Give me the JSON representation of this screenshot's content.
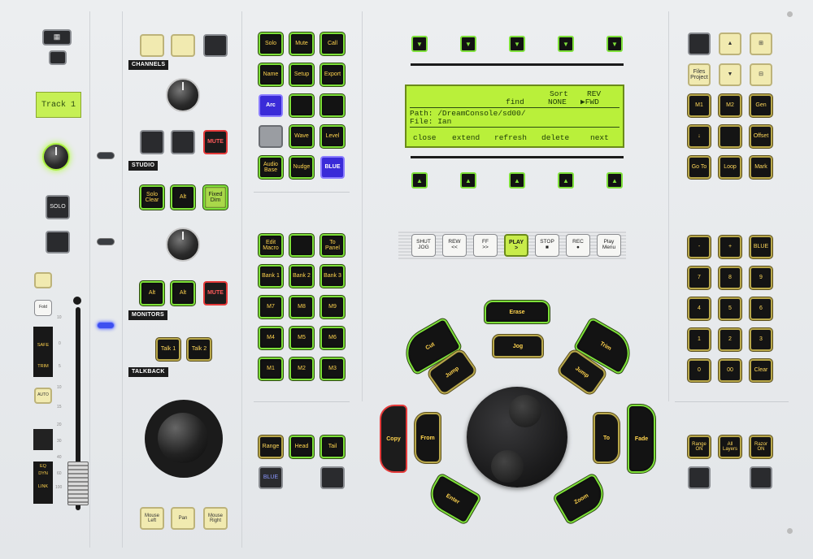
{
  "colors": {
    "panel": "#e8eaed",
    "key_green": "#7ee03a",
    "lcd": "#b9f03a",
    "blue_key": "#3a2bd8",
    "mute_red": "#e43a3a"
  },
  "strip": {
    "track_name": "Track 1",
    "solo": "SOLO",
    "auto": "AUTO",
    "safe_labels": [
      "SAFE",
      "TRIM"
    ],
    "dyn_labels": [
      "EQ",
      "DYN",
      "LINK"
    ],
    "fader_scale": [
      "10",
      "0",
      "5",
      "10",
      "15",
      "20",
      "30",
      "40",
      "60",
      "100"
    ],
    "button_labels": {
      "small1": "",
      "small2": "Fold"
    }
  },
  "sections": {
    "channels": "CHANNELS",
    "studio": "STUDIO",
    "monitors": "MONITORS",
    "talkback": "TALKBACK"
  },
  "channels": {
    "studio_mute": "MUTE",
    "solo_clear": "Solo Clear",
    "alt1": "Alt",
    "fixed_dim": "Fixed Dim",
    "mon_alt1": "Alt",
    "mon_alt2": "Alt",
    "mon_mute": "MUTE",
    "talk1": "Talk 1",
    "talk2": "Talk 2",
    "mouse_left": "Mouse Left",
    "pan": "Pan",
    "mouse_right": "Mouse Right"
  },
  "keys_top": [
    {
      "label": "Solo",
      "style": "green"
    },
    {
      "label": "Mute",
      "style": "green"
    },
    {
      "label": "Call",
      "style": "green"
    },
    {
      "label": "Name",
      "style": "green"
    },
    {
      "label": "Setup",
      "style": "green"
    },
    {
      "label": "Export",
      "style": "green"
    },
    {
      "label": "Arc",
      "style": "blue"
    },
    {
      "label": "",
      "style": "green"
    },
    {
      "label": "",
      "style": "green"
    },
    {
      "label": "",
      "style": "grey"
    },
    {
      "label": "Wave",
      "style": "green"
    },
    {
      "label": "Level",
      "style": "green"
    },
    {
      "label": "Audio Base",
      "style": "green"
    },
    {
      "label": "Nudge",
      "style": "green"
    },
    {
      "label": "BLUE",
      "style": "blue"
    }
  ],
  "keys_mid": [
    {
      "label": "Edit Macro"
    },
    {
      "label": ""
    },
    {
      "label": "To Panel"
    },
    {
      "label": "Bank 1"
    },
    {
      "label": "Bank 2"
    },
    {
      "label": "Bank 3"
    },
    {
      "label": "M7"
    },
    {
      "label": "M8"
    },
    {
      "label": "M9"
    },
    {
      "label": "M4"
    },
    {
      "label": "M5"
    },
    {
      "label": "M6"
    },
    {
      "label": "M1"
    },
    {
      "label": "M2"
    },
    {
      "label": "M3"
    }
  ],
  "keys_bottom": {
    "range": "Range",
    "head": "Head",
    "tail": "Tail",
    "blue": "BLUE"
  },
  "lcd": {
    "header_sort": "Sort",
    "header_rev": "REV",
    "find": "find",
    "none": "NONE",
    "fwd": "▶FWD",
    "path": "Path: /DreamConsole/sd00/",
    "file": "File: Ian",
    "softkeys": [
      "close",
      "extend",
      "refresh",
      "delete",
      "next"
    ]
  },
  "transport": [
    {
      "label": "SHUT\nJOG",
      "lit": false
    },
    {
      "label": "REW\n<<",
      "lit": false
    },
    {
      "label": "FF\n>>",
      "lit": false
    },
    {
      "label": "PLAY\n>",
      "lit": true
    },
    {
      "label": "STOP\n■",
      "lit": false
    },
    {
      "label": "REC\n●",
      "lit": false
    },
    {
      "label": "Play\nMenu",
      "lit": false
    }
  ],
  "jog": {
    "erase": "Erase",
    "cut": "Cut",
    "trim": "Trim",
    "jog": "Jog",
    "jump_left": "Jump",
    "jump_right": "Jump",
    "copy": "Copy",
    "from": "From",
    "to": "To",
    "fade": "Fade",
    "enter": "Enter",
    "zoom": "Zoom"
  },
  "right_top": [
    {
      "label": "",
      "style": "dark"
    },
    {
      "label": "▲",
      "style": "cream"
    },
    {
      "label": "⊞",
      "style": "cream"
    },
    {
      "label": "Files Project",
      "style": "cream"
    },
    {
      "label": "▼",
      "style": "cream"
    },
    {
      "label": "⊟",
      "style": "cream"
    },
    {
      "label": "M1",
      "style": "yellow"
    },
    {
      "label": "M2",
      "style": "yellow"
    },
    {
      "label": "Gen",
      "style": "yellow"
    },
    {
      "label": "↓",
      "style": "yellow"
    },
    {
      "label": "",
      "style": "yellow"
    },
    {
      "label": "Offset",
      "style": "yellow"
    },
    {
      "label": "Go To",
      "style": "yellow"
    },
    {
      "label": "Loop",
      "style": "yellow"
    },
    {
      "label": "Mark",
      "style": "yellow"
    }
  ],
  "keypad": [
    {
      "label": "-"
    },
    {
      "label": "+"
    },
    {
      "label": "BLUE"
    },
    {
      "label": "7"
    },
    {
      "label": "8"
    },
    {
      "label": "9"
    },
    {
      "label": "4"
    },
    {
      "label": "5"
    },
    {
      "label": "6"
    },
    {
      "label": "1"
    },
    {
      "label": "2"
    },
    {
      "label": "3"
    },
    {
      "label": "0"
    },
    {
      "label": "00"
    },
    {
      "label": "Clear"
    }
  ],
  "right_bottom": {
    "range_on": "Range ON",
    "all_layers": "All Layers",
    "razor_on": "Razor ON"
  }
}
